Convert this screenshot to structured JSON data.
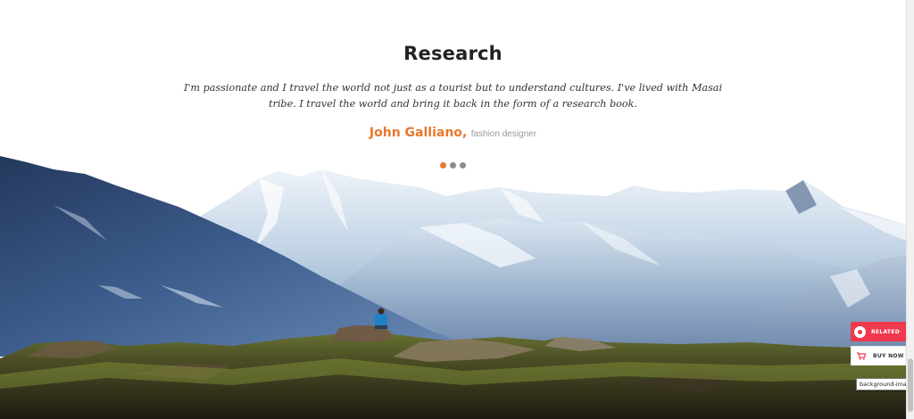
{
  "testimonial": {
    "title": "Research",
    "quote": "I'm passionate and I travel the world not just as a tourist but to understand cultures. I've lived with Masai tribe. I travel the world and bring it back in the form of a research book.",
    "author": "John Galliano,",
    "role": "fashion designer",
    "slide_count": 3,
    "active_slide": 1
  },
  "side_buttons": {
    "related": {
      "label": "RELATED",
      "icon": "map-pin-icon"
    },
    "buy": {
      "label": "BUY NOW",
      "icon": "cart-icon"
    }
  },
  "tooltip": {
    "text": "background-image"
  },
  "background": {
    "subject": "mountain-landscape-image"
  },
  "colors": {
    "accent_orange": "#e8772e",
    "related_red": "#f0394f",
    "title": "#222222",
    "quote": "#333333",
    "role": "#9a9a9a"
  }
}
